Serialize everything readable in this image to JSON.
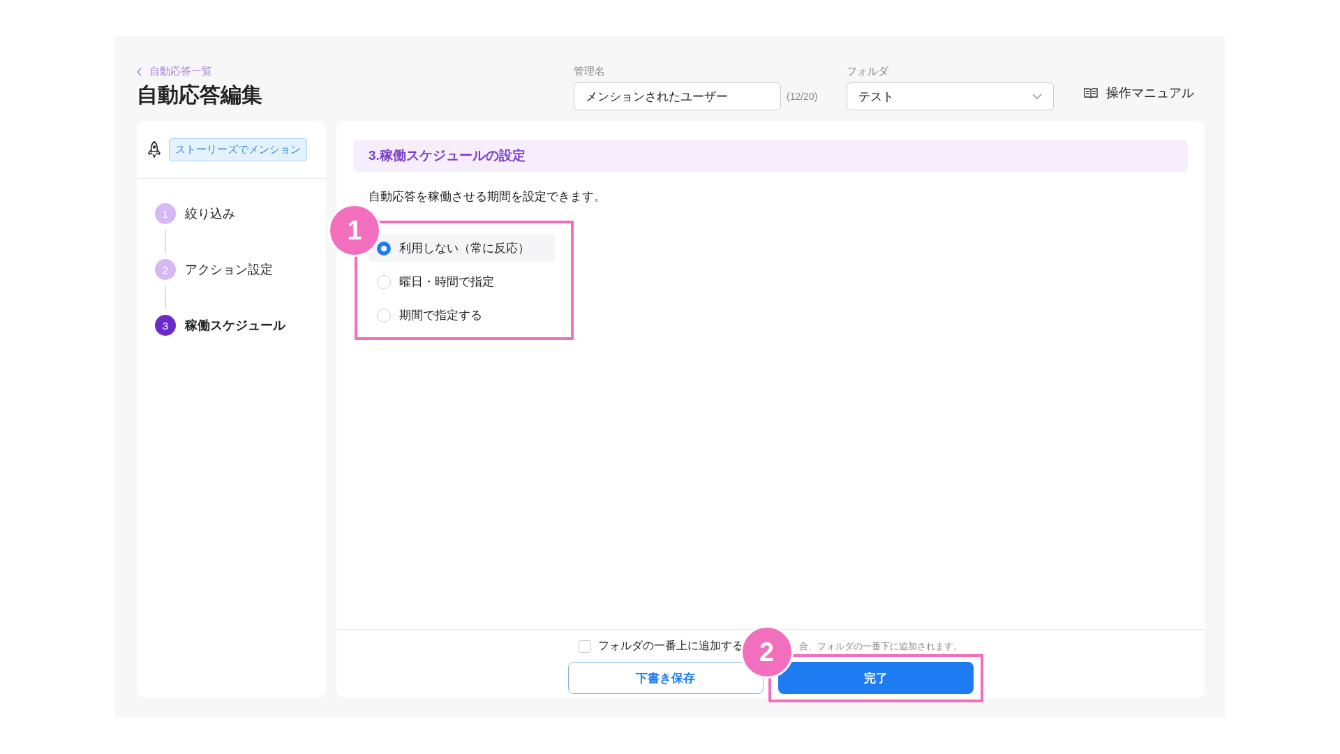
{
  "breadcrumb": "自動応答一覧",
  "title": "自動応答編集",
  "name_field": {
    "label": "管理名",
    "value": "メンションされたユーザー",
    "counter": "(12/20)"
  },
  "folder_field": {
    "label": "フォルダ",
    "value": "テスト"
  },
  "manual_link": "操作マニュアル",
  "sidebar": {
    "trigger_tag": "ストーリーズでメンション",
    "steps": [
      {
        "number": "1",
        "label": "絞り込み",
        "selected": false
      },
      {
        "number": "2",
        "label": "アクション設定",
        "selected": false
      },
      {
        "number": "3",
        "label": "稼働スケジュール",
        "selected": true
      }
    ]
  },
  "section": {
    "title": "3.稼働スケジュールの設定",
    "description": "自動応答を稼働させる期間を設定できます。",
    "callout": "1",
    "options": [
      {
        "label": "利用しない（常に反応）",
        "selected": true
      },
      {
        "label": "曜日・時間で指定",
        "selected": false
      },
      {
        "label": "期間で指定する",
        "selected": false
      }
    ]
  },
  "footer": {
    "checkbox": {
      "label": "フォルダの一番上に追加する",
      "checked": false
    },
    "hint": "合、フォルダの一番下に追加されます。",
    "callout": "2",
    "buttons": [
      {
        "kind": "secondary",
        "label": "下書き保存"
      },
      {
        "kind": "primary",
        "label": "完了"
      }
    ]
  }
}
